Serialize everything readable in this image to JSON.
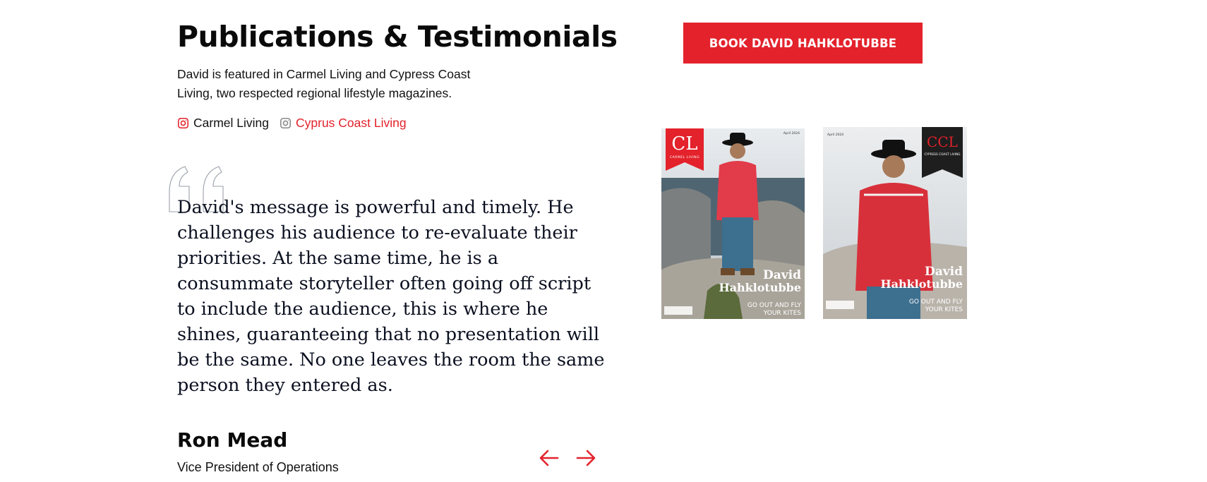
{
  "section": {
    "title": "Publications & Testimonials",
    "intro": "David is featured in Carmel Living and Cypress Coast Living, two respected regional lifestyle magazines."
  },
  "links": [
    {
      "label": "Carmel Living",
      "icon": "instagram-icon",
      "color": "#e3222b"
    },
    {
      "label": "Cyprus Coast Living",
      "icon": "instagram-icon",
      "color": "#e3222b"
    }
  ],
  "testimonial": {
    "quote": "David's message is powerful and timely. He challenges his audience to re-evaluate their priorities. At the same time, he is a consummate storyteller often going off script to include the audience, this is where he shines, guaranteeing that no presentation will be the same. No one leaves the room the same person they entered as.",
    "author": "Ron Mead",
    "role": "Vice President of Operations"
  },
  "carousel": {
    "prev_icon": "arrow-left-icon",
    "next_icon": "arrow-right-icon"
  },
  "cta": {
    "label": "BOOK DAVID HAHKLOTUBBE",
    "color": "#e3222b"
  },
  "covers": [
    {
      "masthead": "CL",
      "magazine": "CARMEL LIVING",
      "date": "April 2024",
      "name_line1": "David",
      "name_line2": "Hahklotubbe",
      "tagline_line1": "GO OUT AND FLY",
      "tagline_line2": "YOUR KITES"
    },
    {
      "masthead": "CCL",
      "magazine": "CYPRESS COAST LIVING",
      "date": "April 2024",
      "name_line1": "David",
      "name_line2": "Hahklotubbe",
      "tagline_line1": "GO OUT AND FLY",
      "tagline_line2": "YOUR KITES"
    }
  ],
  "colors": {
    "accent": "#e3222b",
    "text": "#0b0f1a"
  }
}
